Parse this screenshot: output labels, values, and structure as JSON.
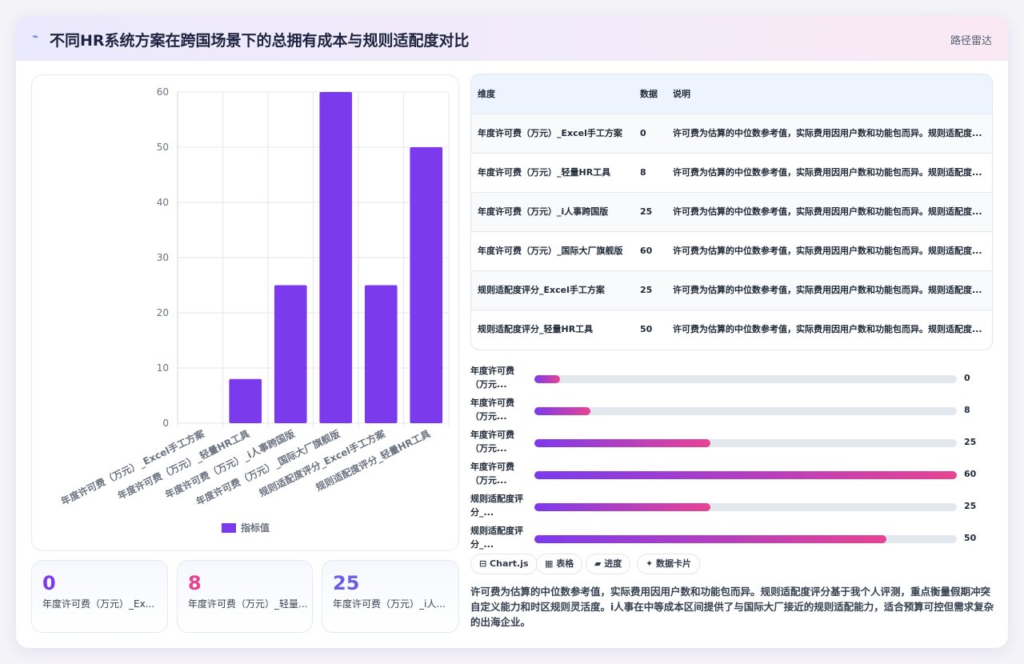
{
  "header": {
    "icon": "line-chart-icon",
    "title": "不同HR系统方案在跨国场景下的总拥有成本与规则适配度对比",
    "badge": "路径雷达"
  },
  "chart_data": {
    "type": "bar",
    "categories": [
      "年度许可费（万元）_Excel手工方案",
      "年度许可费（万元）_轻量HR工具",
      "年度许可费（万元）_i人事跨国版",
      "年度许可费（万元）_国际大厂旗舰版",
      "规则适配度评分_Excel手工方案",
      "规则适配度评分_轻量HR工具"
    ],
    "series": [
      {
        "name": "指标值",
        "values": [
          0,
          8,
          25,
          60,
          25,
          50
        ],
        "color": "#7c3aed"
      }
    ],
    "yticks": [
      "0",
      "10",
      "20",
      "30",
      "40",
      "50",
      "60"
    ],
    "ylim": [
      0,
      60
    ],
    "grid": true,
    "legend": "bottom"
  },
  "kpis": [
    {
      "value": "0",
      "label": "年度许可费（万元）_Ex...",
      "color": "#7c3aed"
    },
    {
      "value": "8",
      "label": "年度许可费（万元）_轻量...",
      "color": "#e84393"
    },
    {
      "value": "25",
      "label": "年度许可费（万元）_i人...",
      "color": "#6c5ce7"
    }
  ],
  "table": {
    "headers": [
      "维度",
      "数据",
      "说明"
    ],
    "rows": [
      {
        "dim": "年度许可费（万元）_Excel手工方案",
        "val": "0",
        "desc": "许可费为估算的中位数参考值，实际费用因用户数和功能包而异。规则适配度..."
      },
      {
        "dim": "年度许可费（万元）_轻量HR工具",
        "val": "8",
        "desc": "许可费为估算的中位数参考值，实际费用因用户数和功能包而异。规则适配度..."
      },
      {
        "dim": "年度许可费（万元）_i人事跨国版",
        "val": "25",
        "desc": "许可费为估算的中位数参考值，实际费用因用户数和功能包而异。规则适配度..."
      },
      {
        "dim": "年度许可费（万元）_国际大厂旗舰版",
        "val": "60",
        "desc": "许可费为估算的中位数参考值，实际费用因用户数和功能包而异。规则适配度..."
      },
      {
        "dim": "规则适配度评分_Excel手工方案",
        "val": "25",
        "desc": "许可费为估算的中位数参考值，实际费用因用户数和功能包而异。规则适配度..."
      },
      {
        "dim": "规则适配度评分_轻量HR工具",
        "val": "50",
        "desc": "许可费为估算的中位数参考值，实际费用因用户数和功能包而异。规则适配度..."
      }
    ]
  },
  "progress": {
    "max": 60,
    "items": [
      {
        "label": "年度许可费（万元...",
        "value": 0,
        "display": "0"
      },
      {
        "label": "年度许可费（万元...",
        "value": 8,
        "display": "8"
      },
      {
        "label": "年度许可费（万元...",
        "value": 25,
        "display": "25"
      },
      {
        "label": "年度许可费（万元...",
        "value": 60,
        "display": "60"
      },
      {
        "label": "规则适配度评分_...",
        "value": 25,
        "display": "25"
      },
      {
        "label": "规则适配度评分_...",
        "value": 50,
        "display": "50"
      }
    ]
  },
  "tags": [
    "⊟ Chart.js",
    "▦ 表格",
    "▰ 进度",
    "✦ 数据卡片"
  ],
  "note": "许可费为估算的中位数参考值，实际费用因用户数和功能包而异。规则适配度评分基于我个人评测，重点衡量假期冲突自定义能力和时区规则灵活度。i人事在中等成本区间提供了与国际大厂接近的规则适配能力，适合预算可控但需求复杂的出海企业。"
}
